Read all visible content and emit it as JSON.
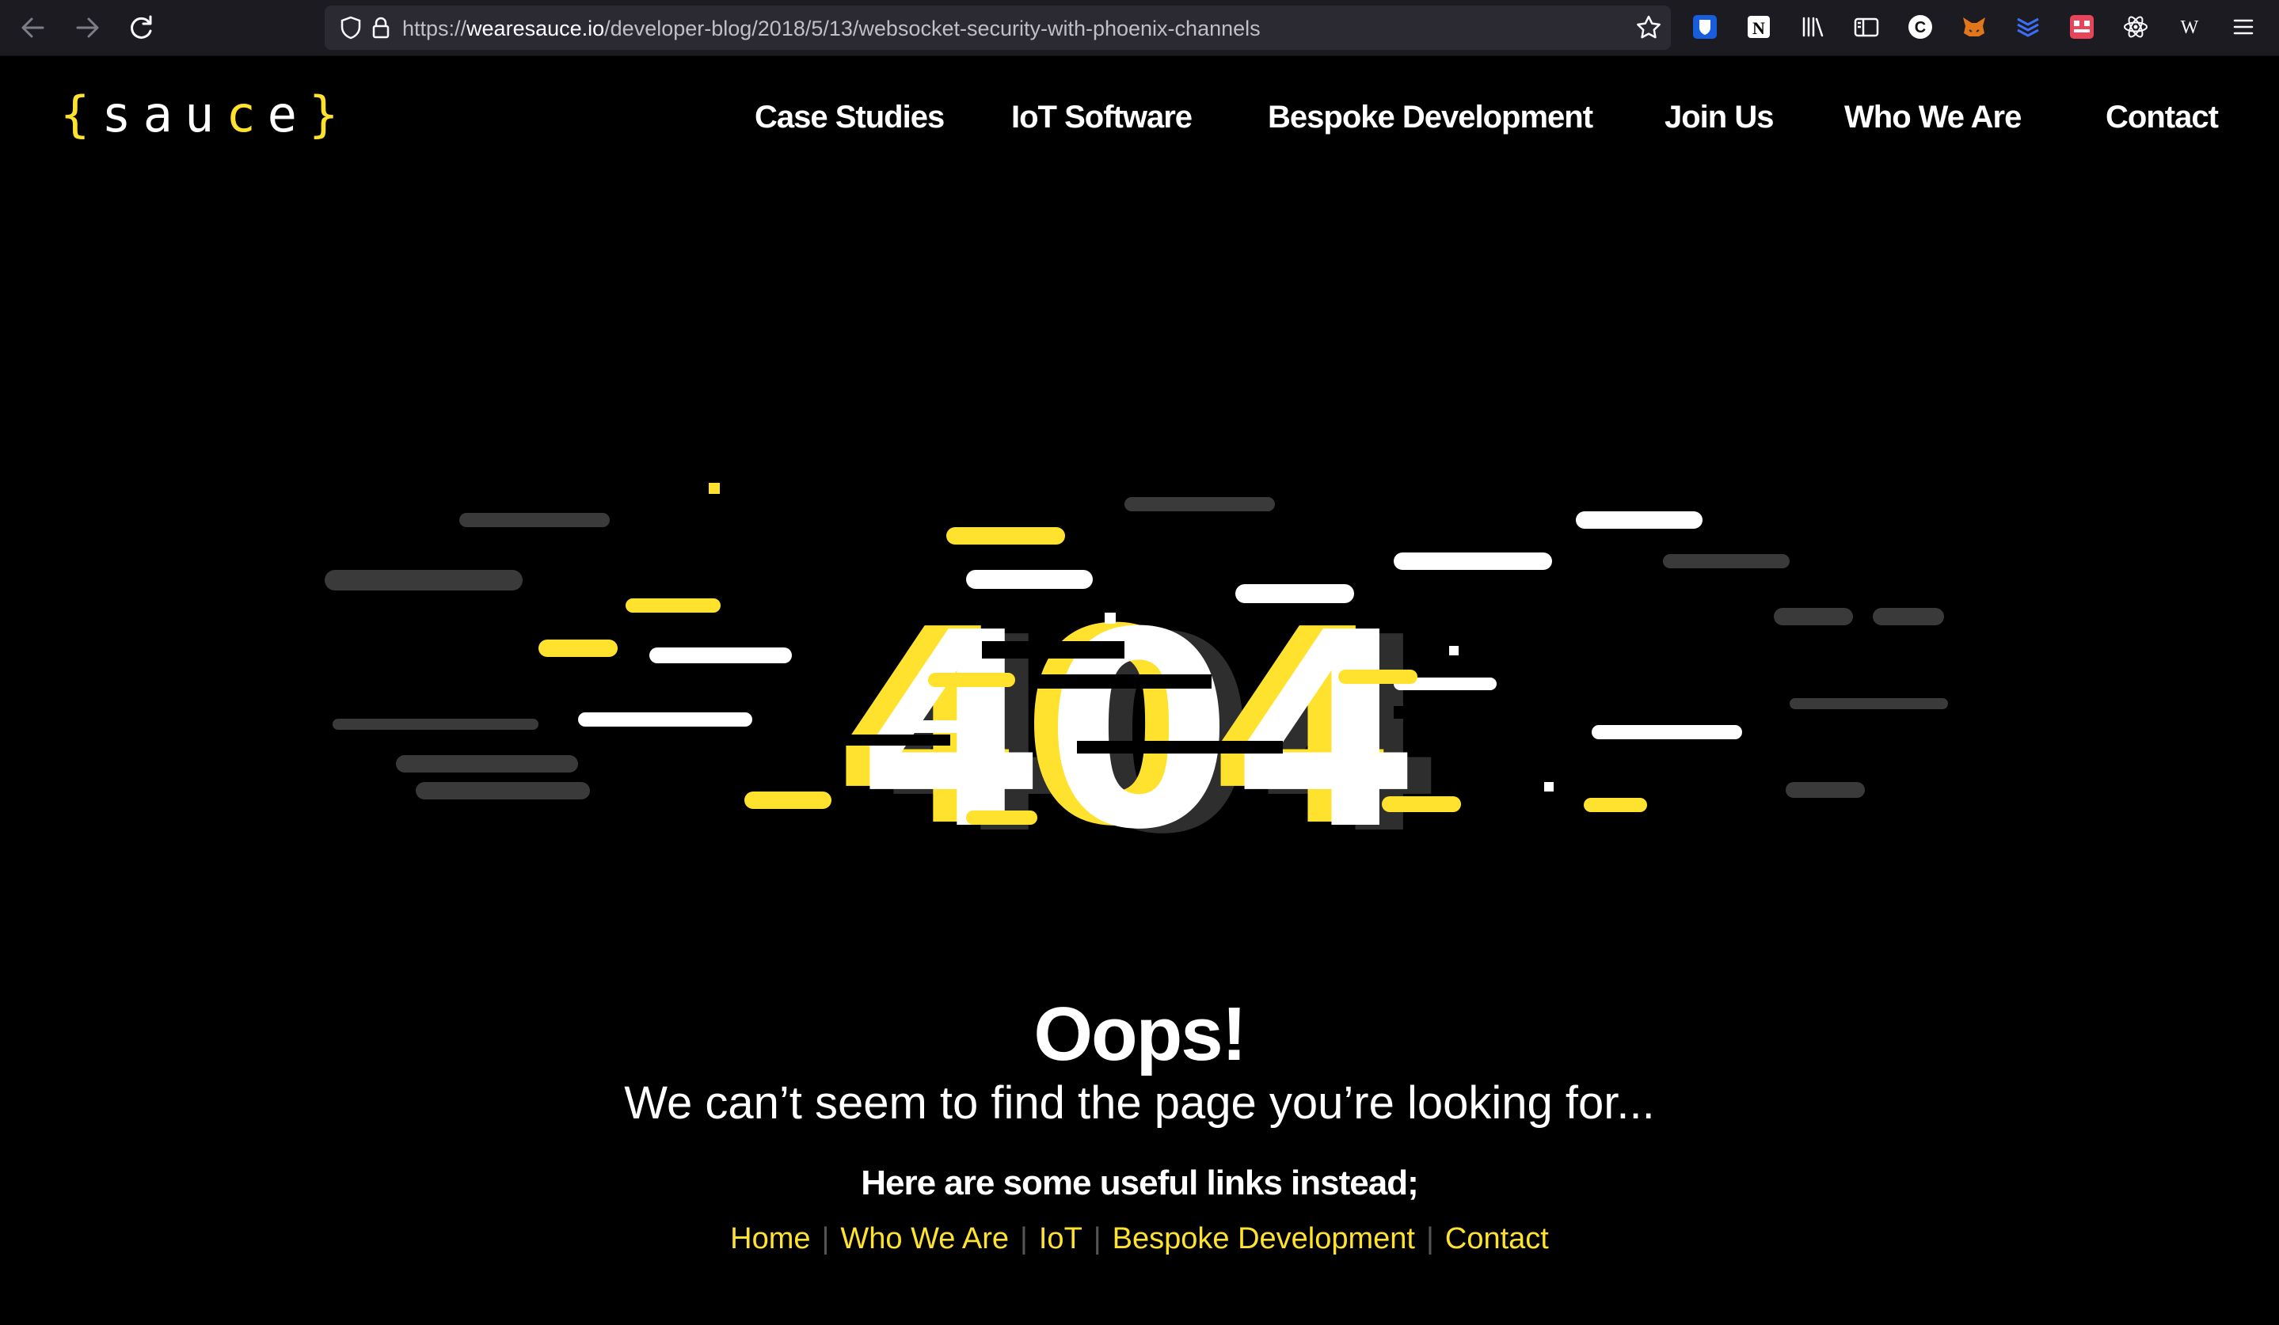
{
  "browser": {
    "url_scheme": "https://",
    "url_host": "wearesauce.io",
    "url_path": "/developer-blog/2018/5/13/websocket-security-with-phoenix-channels",
    "icons": [
      "back-arrow-icon",
      "forward-arrow-icon",
      "reload-icon",
      "shield-icon",
      "lock-icon",
      "bookmark-star-icon",
      "bitwarden-icon",
      "notion-icon",
      "library-icon",
      "sidebar-icon",
      "c-extension-icon",
      "metamask-fox-icon",
      "layers-icon",
      "grid-extension-icon",
      "react-devtools-icon",
      "wikipedia-icon",
      "hamburger-menu-icon"
    ]
  },
  "site": {
    "logo": {
      "open": "{",
      "letters_a": "sau",
      "letter_c": "c",
      "letters_b": "e",
      "close": "}"
    },
    "nav": [
      "Case Studies",
      "IoT Software",
      "Bespoke Development",
      "Join Us",
      "Who We Are",
      "Contact"
    ]
  },
  "error": {
    "code": "404",
    "title": "Oops!",
    "message": "We can’t seem to find the page you’re looking for...",
    "links_heading": "Here are some useful links instead;",
    "links": [
      "Home",
      "Who We Are",
      "IoT",
      "Bespoke Development",
      "Contact"
    ]
  },
  "colors": {
    "accent": "#ffe22d",
    "background": "#000000",
    "text": "#ffffff",
    "chrome": "#1c1b22"
  }
}
